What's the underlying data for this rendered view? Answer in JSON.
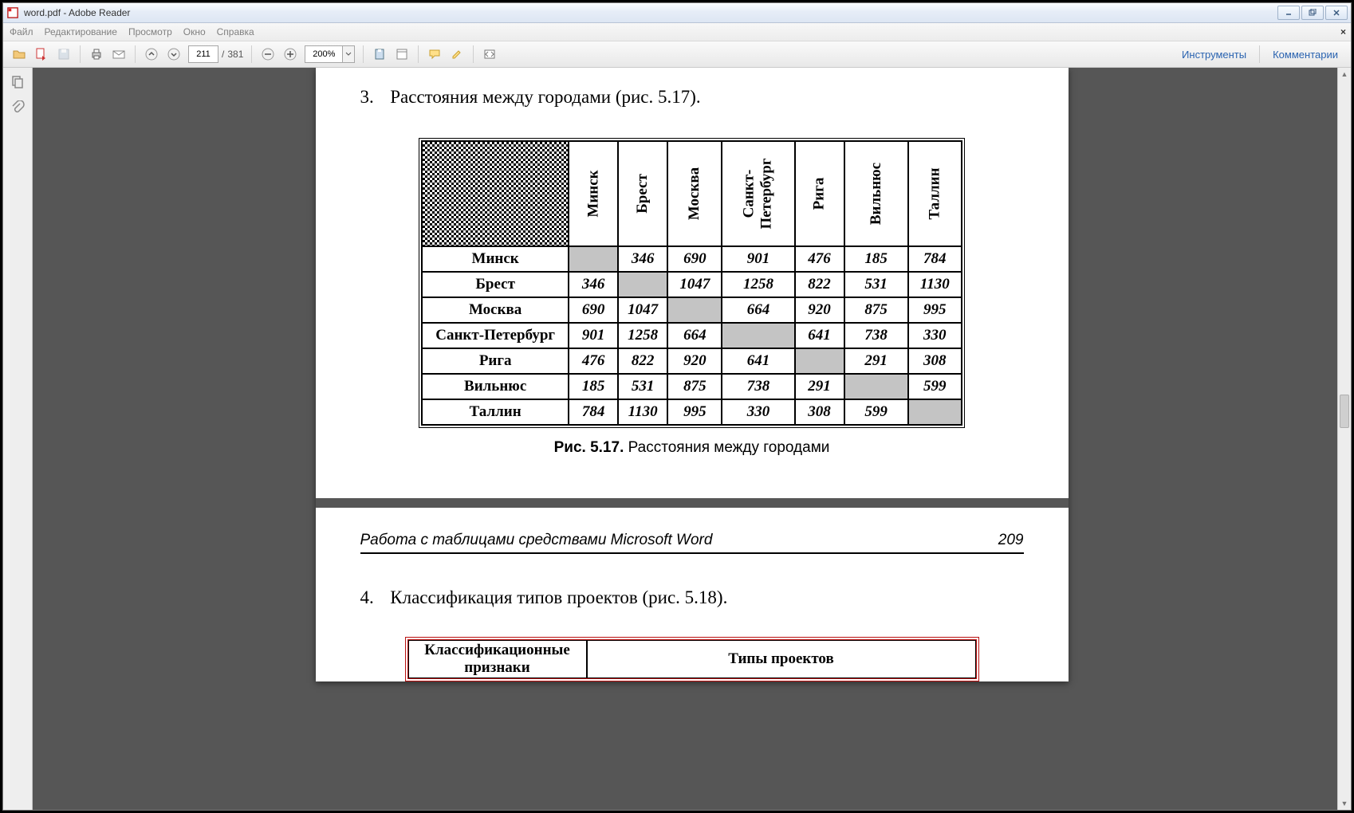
{
  "app": {
    "title": "word.pdf - Adobe Reader"
  },
  "menu": {
    "file": "Файл",
    "edit": "Редактирование",
    "view": "Просмотр",
    "window": "Окно",
    "help": "Справка"
  },
  "toolbar": {
    "page_current": "211",
    "page_sep": "/",
    "page_total": "381",
    "zoom": "200%",
    "tools": "Инструменты",
    "comments": "Комментарии"
  },
  "doc": {
    "item3_num": "3.",
    "item3_text": "Расстояния между городами (рис. 5.17).",
    "cities": [
      "Минск",
      "Брест",
      "Москва",
      "Санкт-Петербург",
      "Рига",
      "Вильнюс",
      "Таллин"
    ],
    "cities_header_sp": "Санкт-\nПетербург",
    "rows": [
      {
        "name": "Минск",
        "vals": [
          "",
          "346",
          "690",
          "901",
          "476",
          "185",
          "784"
        ]
      },
      {
        "name": "Брест",
        "vals": [
          "346",
          "",
          "1047",
          "1258",
          "822",
          "531",
          "1130"
        ]
      },
      {
        "name": "Москва",
        "vals": [
          "690",
          "1047",
          "",
          "664",
          "920",
          "875",
          "995"
        ]
      },
      {
        "name": "Санкт-Петербург",
        "vals": [
          "901",
          "1258",
          "664",
          "",
          "641",
          "738",
          "330"
        ]
      },
      {
        "name": "Рига",
        "vals": [
          "476",
          "822",
          "920",
          "641",
          "",
          "291",
          "308"
        ]
      },
      {
        "name": "Вильнюс",
        "vals": [
          "185",
          "531",
          "875",
          "738",
          "291",
          "",
          "599"
        ]
      },
      {
        "name": "Таллин",
        "vals": [
          "784",
          "1130",
          "995",
          "330",
          "308",
          "599",
          ""
        ]
      }
    ],
    "fig517_label": "Рис. 5.17.",
    "fig517_text": " Расстояния между городами",
    "runner_title": "Работа с таблицами средствами Microsoft Word",
    "runner_page": "209",
    "item4_num": "4.",
    "item4_text": "Классификация типов проектов (рис. 5.18).",
    "t2_h1": "Классификационные признаки",
    "t2_h2": "Типы проектов"
  }
}
